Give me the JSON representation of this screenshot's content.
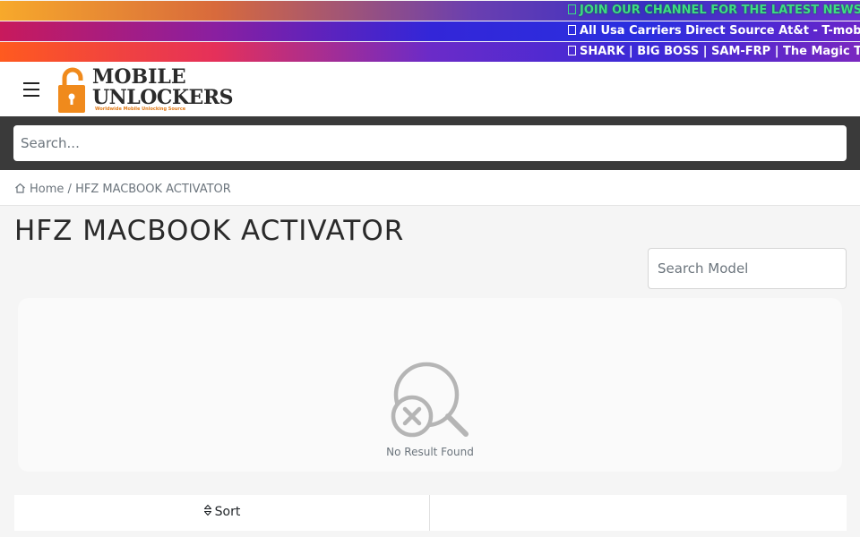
{
  "tickers": [
    {
      "text": "JOIN OUR CHANNEL FOR THE LATEST NEWS"
    },
    {
      "text": "All Usa Carriers Direct Source At&t - T-mobile"
    },
    {
      "text": "SHARK | BIG BOSS | SAM-FRP | The Magic Too"
    }
  ],
  "header": {
    "logo_line1": "MOBILE",
    "logo_line2": "UNLOCKERS",
    "logo_tagline": "Worldwide Mobile Unlocking Source",
    "logo_color": "#f08a1c"
  },
  "search": {
    "placeholder": "Search..."
  },
  "breadcrumb": {
    "home": "Home",
    "separator": "/",
    "current": "HFZ MACBOOK ACTIVATOR"
  },
  "page": {
    "title": "HFZ MACBOOK ACTIVATOR"
  },
  "model_search": {
    "placeholder": "Search Model"
  },
  "results": {
    "empty_text": "No Result Found",
    "icon": "search-no-result-icon"
  },
  "sort": {
    "label": "Sort",
    "icon": "sort-arrows-icon"
  }
}
